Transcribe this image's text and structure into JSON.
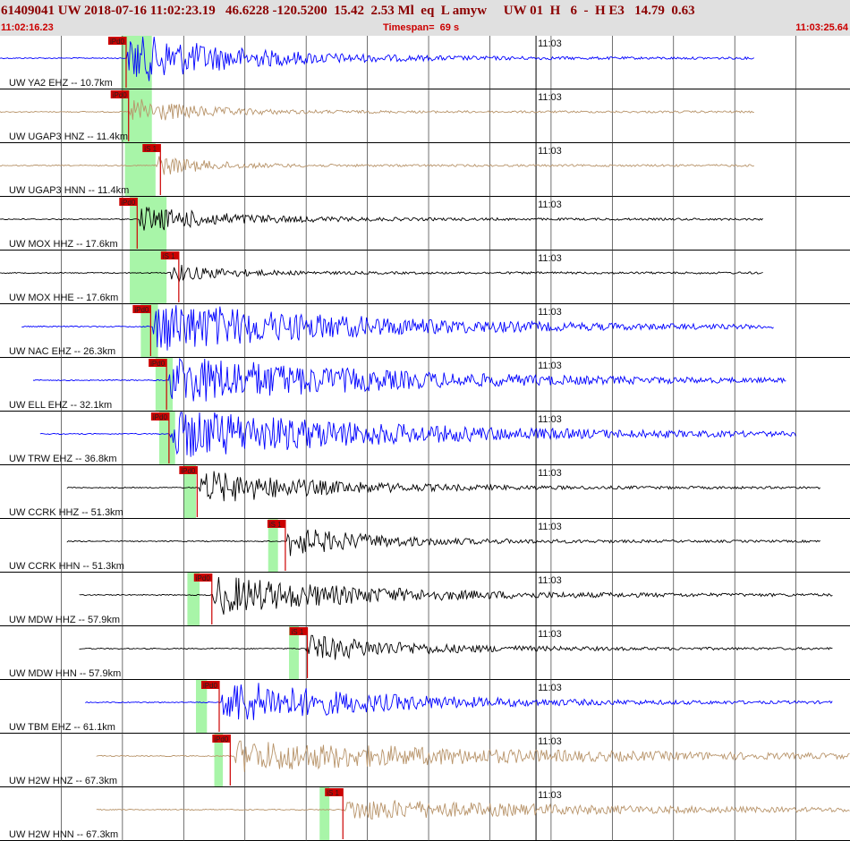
{
  "header": {
    "title": "61409041 UW 2018-07-16 11:02:23.19   46.6228 -120.5200  15.42  2.53 Ml  eq  L amyw     UW 01  H   6  -  H E3   14.79  0.63",
    "start_time": "11:02:16.23",
    "timespan": "Timespan=  69 s",
    "end_time": "11:03:25.64"
  },
  "colors": {
    "blue": "#0000ff",
    "tan": "#b8946a",
    "black": "#000000",
    "pick": "#cc0000",
    "green": "#a8f5a8",
    "grid": "#000000"
  },
  "chart_data": {
    "type": "line",
    "title": "61409041 UW 2018-07-16 11:02:23.19",
    "x_unit": "s",
    "xlim": [
      0,
      69.41
    ],
    "minute_mark_label": "11:03",
    "minute_mark_time": 43.77,
    "traces": [
      {
        "label": "UW YA2 EHZ -- 10.7km",
        "color": "blue",
        "data_start": 0,
        "data_end": 61.6,
        "onset": 10.4,
        "coda_end": 30,
        "amp": 1.0,
        "pick": "iPd0",
        "pick_time": 10.3,
        "green": [
          9.9,
          12.4
        ]
      },
      {
        "label": "UW UGAP3 HNZ -- 11.4km",
        "color": "tan",
        "data_start": 0,
        "data_end": 61.6,
        "onset": 10.6,
        "coda_end": 22,
        "amp": 0.55,
        "pick": "iPd0",
        "pick_time": 10.5,
        "green": [
          9.9,
          12.4
        ]
      },
      {
        "label": "UW UGAP3 HNN -- 11.4km",
        "color": "tan",
        "data_start": 0,
        "data_end": 61.6,
        "onset": 12.6,
        "coda_end": 22,
        "amp": 0.4,
        "pick": "iS 1",
        "pick_time": 13.1,
        "green": [
          10.2,
          12.7
        ]
      },
      {
        "label": "UW MOX HHZ -- 17.6km",
        "color": "black",
        "data_start": 0,
        "data_end": 62.3,
        "onset": 11.3,
        "coda_end": 27,
        "amp": 0.5,
        "pick": "iPd0",
        "pick_time": 11.2,
        "green": [
          10.6,
          13.6
        ]
      },
      {
        "label": "UW MOX HHE -- 17.6km",
        "color": "black",
        "data_start": 0,
        "data_end": 62.3,
        "onset": 13.8,
        "coda_end": 24,
        "amp": 0.35,
        "pick": "iS 1",
        "pick_time": 14.6,
        "green": [
          10.6,
          13.6
        ]
      },
      {
        "label": "UW NAC EHZ -- 26.3km",
        "color": "blue",
        "data_start": 1.8,
        "data_end": 63.2,
        "onset": 12.5,
        "coda_end": 48,
        "amp": 1.0,
        "pick": "iPd0",
        "pick_time": 12.3,
        "green": [
          11.5,
          12.9
        ]
      },
      {
        "label": "UW ELL EHZ -- 32.1km",
        "color": "blue",
        "data_start": 2.7,
        "data_end": 64.2,
        "onset": 13.8,
        "coda_end": 50,
        "amp": 1.0,
        "pick": "iPd0",
        "pick_time": 13.6,
        "green": [
          12.7,
          14.1
        ]
      },
      {
        "label": "UW TRW EHZ -- 36.8km",
        "color": "blue",
        "data_start": 3.3,
        "data_end": 65.0,
        "onset": 13.9,
        "coda_end": 52,
        "amp": 1.0,
        "pick": "iPd0",
        "pick_time": 13.8,
        "green": [
          13.0,
          14.3
        ]
      },
      {
        "label": "UW CCRK HHZ -- 51.3km",
        "color": "black",
        "data_start": 5.5,
        "data_end": 67.0,
        "onset": 16.3,
        "coda_end": 38,
        "amp": 0.65,
        "pick": "iPd0",
        "pick_time": 16.1,
        "green": [
          15.0,
          16.0
        ]
      },
      {
        "label": "UW CCRK HHN -- 51.3km",
        "color": "black",
        "data_start": 5.5,
        "data_end": 67.0,
        "onset": 23.3,
        "coda_end": 40,
        "amp": 0.55,
        "pick": "iS 1",
        "pick_time": 23.3,
        "green": [
          21.9,
          22.7
        ]
      },
      {
        "label": "UW MDW HHZ -- 57.9km",
        "color": "black",
        "data_start": 6.5,
        "data_end": 68.0,
        "onset": 17.4,
        "coda_end": 44,
        "amp": 0.75,
        "pick": "iPd0",
        "pick_time": 17.3,
        "green": [
          15.3,
          16.3
        ]
      },
      {
        "label": "UW MDW HHN -- 57.9km",
        "color": "black",
        "data_start": 6.5,
        "data_end": 68.0,
        "onset": 25.0,
        "coda_end": 44,
        "amp": 0.5,
        "pick": "iS 1",
        "pick_time": 25.1,
        "green": [
          23.6,
          24.4
        ]
      },
      {
        "label": "UW TBM EHZ -- 61.1km",
        "color": "blue",
        "data_start": 7.0,
        "data_end": 68.0,
        "onset": 18.1,
        "coda_end": 44,
        "amp": 0.9,
        "pick": "iPd0",
        "pick_time": 17.9,
        "green": [
          16.0,
          16.9
        ]
      },
      {
        "label": "UW H2W HNZ -- 67.3km",
        "color": "tan",
        "data_start": 7.9,
        "data_end": 69.41,
        "onset": 19.0,
        "coda_end": 69.41,
        "amp": 0.6,
        "pick": "iPd0",
        "pick_time": 18.8,
        "green": [
          17.5,
          18.2
        ]
      },
      {
        "label": "UW H2W HNN -- 67.3km",
        "color": "tan",
        "data_start": 7.9,
        "data_end": 69.41,
        "onset": 28.1,
        "coda_end": 69.41,
        "amp": 0.4,
        "pick": "iS 1",
        "pick_time": 28.0,
        "green": [
          26.1,
          26.9
        ]
      }
    ]
  }
}
